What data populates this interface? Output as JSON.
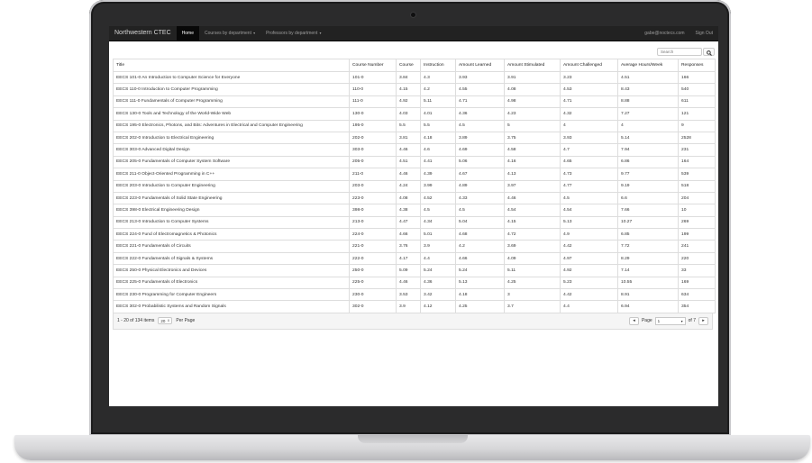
{
  "navbar": {
    "brand": "Northwestern CTEC",
    "home": "Home",
    "courses_by_department": "Courses by department",
    "professors_by_department": "Professors by department",
    "user_email": "gabe@noctecs.com",
    "sign_out": "Sign Out"
  },
  "search": {
    "placeholder": "Search"
  },
  "table": {
    "headers": [
      "Title",
      "Course Number",
      "Course",
      "Instruction",
      "Amount Learned",
      "Amount Stimulated",
      "Amount Challenged",
      "Average Hours/Week",
      "Responses"
    ],
    "rows": [
      [
        "EECS 101-0 An Introduction to Computer Science for Everyone",
        "101-0",
        "3.84",
        "4.3",
        "3.93",
        "3.91",
        "3.23",
        "4.51",
        "166"
      ],
      [
        "EECS 110-0 Introduction to Computer Programming",
        "110-0",
        "4.15",
        "4.2",
        "4.55",
        "4.08",
        "4.53",
        "8.43",
        "540"
      ],
      [
        "EECS 111-0 Fundamentals of Computer Programming",
        "111-0",
        "4.92",
        "5.11",
        "4.71",
        "4.98",
        "4.71",
        "8.88",
        "611"
      ],
      [
        "EECS 130-0 Tools and Technology of the World-Wide Web",
        "130-0",
        "4.03",
        "4.01",
        "4.36",
        "4.23",
        "4.32",
        "7.27",
        "121"
      ],
      [
        "EECS 195-0 Electronics, Photons, and Bits: Adventures in Electrical and Computer Engineering",
        "195-0",
        "5.5",
        "5.5",
        "4.5",
        "5",
        "4",
        "4",
        "9"
      ],
      [
        "EECS 202-0 Introduction to Electrical Engineering",
        "202-0",
        "3.81",
        "4.18",
        "3.89",
        "3.75",
        "3.93",
        "5.14",
        "2528"
      ],
      [
        "EECS 303-0 Advanced Digital Design",
        "303-0",
        "4.46",
        "4.6",
        "4.69",
        "4.58",
        "4.7",
        "7.94",
        "231"
      ],
      [
        "EECS 205-0 Fundamentals of Computer System Software",
        "205-0",
        "4.51",
        "4.41",
        "5.06",
        "4.16",
        "4.65",
        "6.86",
        "164"
      ],
      [
        "EECS 211-0 Object-Oriented Programming in C++",
        "211-0",
        "4.46",
        "4.39",
        "4.67",
        "4.13",
        "4.73",
        "9.77",
        "539"
      ],
      [
        "EECS 203-0 Introduction to Computer Engineering",
        "203-0",
        "4.24",
        "3.99",
        "4.89",
        "3.97",
        "4.77",
        "9.19",
        "518"
      ],
      [
        "EECS 223-0 Fundamentals of Solid State Engineering",
        "223-0",
        "4.08",
        "4.52",
        "4.33",
        "4.46",
        "4.5",
        "6.6",
        "204"
      ],
      [
        "EECS 398-0 Electrical Engineering Design",
        "398-0",
        "4.38",
        "4.5",
        "4.5",
        "4.54",
        "4.54",
        "7.66",
        "10"
      ],
      [
        "EECS 213-0 Introduction to Computer Systems",
        "213-0",
        "4.47",
        "4.34",
        "5.04",
        "4.15",
        "5.13",
        "10.27",
        "269"
      ],
      [
        "EECS 224-0 Fund of Electromagnetics & Photonics",
        "224-0",
        "4.66",
        "5.01",
        "4.68",
        "4.72",
        "4.9",
        "6.85",
        "199"
      ],
      [
        "EECS 221-0 Fundamentals of Circuits",
        "221-0",
        "3.76",
        "3.9",
        "4.2",
        "3.69",
        "4.42",
        "7.72",
        "241"
      ],
      [
        "EECS 222-0 Fundamentals of Signals & Systems",
        "222-0",
        "4.17",
        "4.4",
        "4.66",
        "4.09",
        "4.97",
        "8.29",
        "220"
      ],
      [
        "EECS 250-0 Physical Electronics and Devices",
        "250-0",
        "5.09",
        "5.24",
        "5.24",
        "5.11",
        "4.92",
        "7.14",
        "33"
      ],
      [
        "EECS 225-0 Fundamentals of Electronics",
        "225-0",
        "4.46",
        "4.36",
        "5.13",
        "4.25",
        "5.23",
        "10.55",
        "169"
      ],
      [
        "EECS 230-0 Programming for Computer Engineers",
        "230-0",
        "3.53",
        "3.42",
        "4.18",
        "3",
        "4.42",
        "8.91",
        "634"
      ],
      [
        "EECS 302-0 Probabilistic Systems and Random Signals",
        "302-0",
        "3.9",
        "4.12",
        "4.25",
        "3.7",
        "4.4",
        "6.94",
        "354"
      ]
    ]
  },
  "pager": {
    "items_summary": "1 - 20 of 134 items",
    "page_size": "20",
    "per_page_label": "Per Page",
    "page_label": "Page",
    "current_page": "1",
    "of_label": "of 7",
    "prev_icon": "chevron-left-icon",
    "next_icon": "chevron-right-icon"
  },
  "colors": {
    "navbar_bg": "#222222",
    "navbar_active_bg": "#080808",
    "border": "#dddddd"
  }
}
